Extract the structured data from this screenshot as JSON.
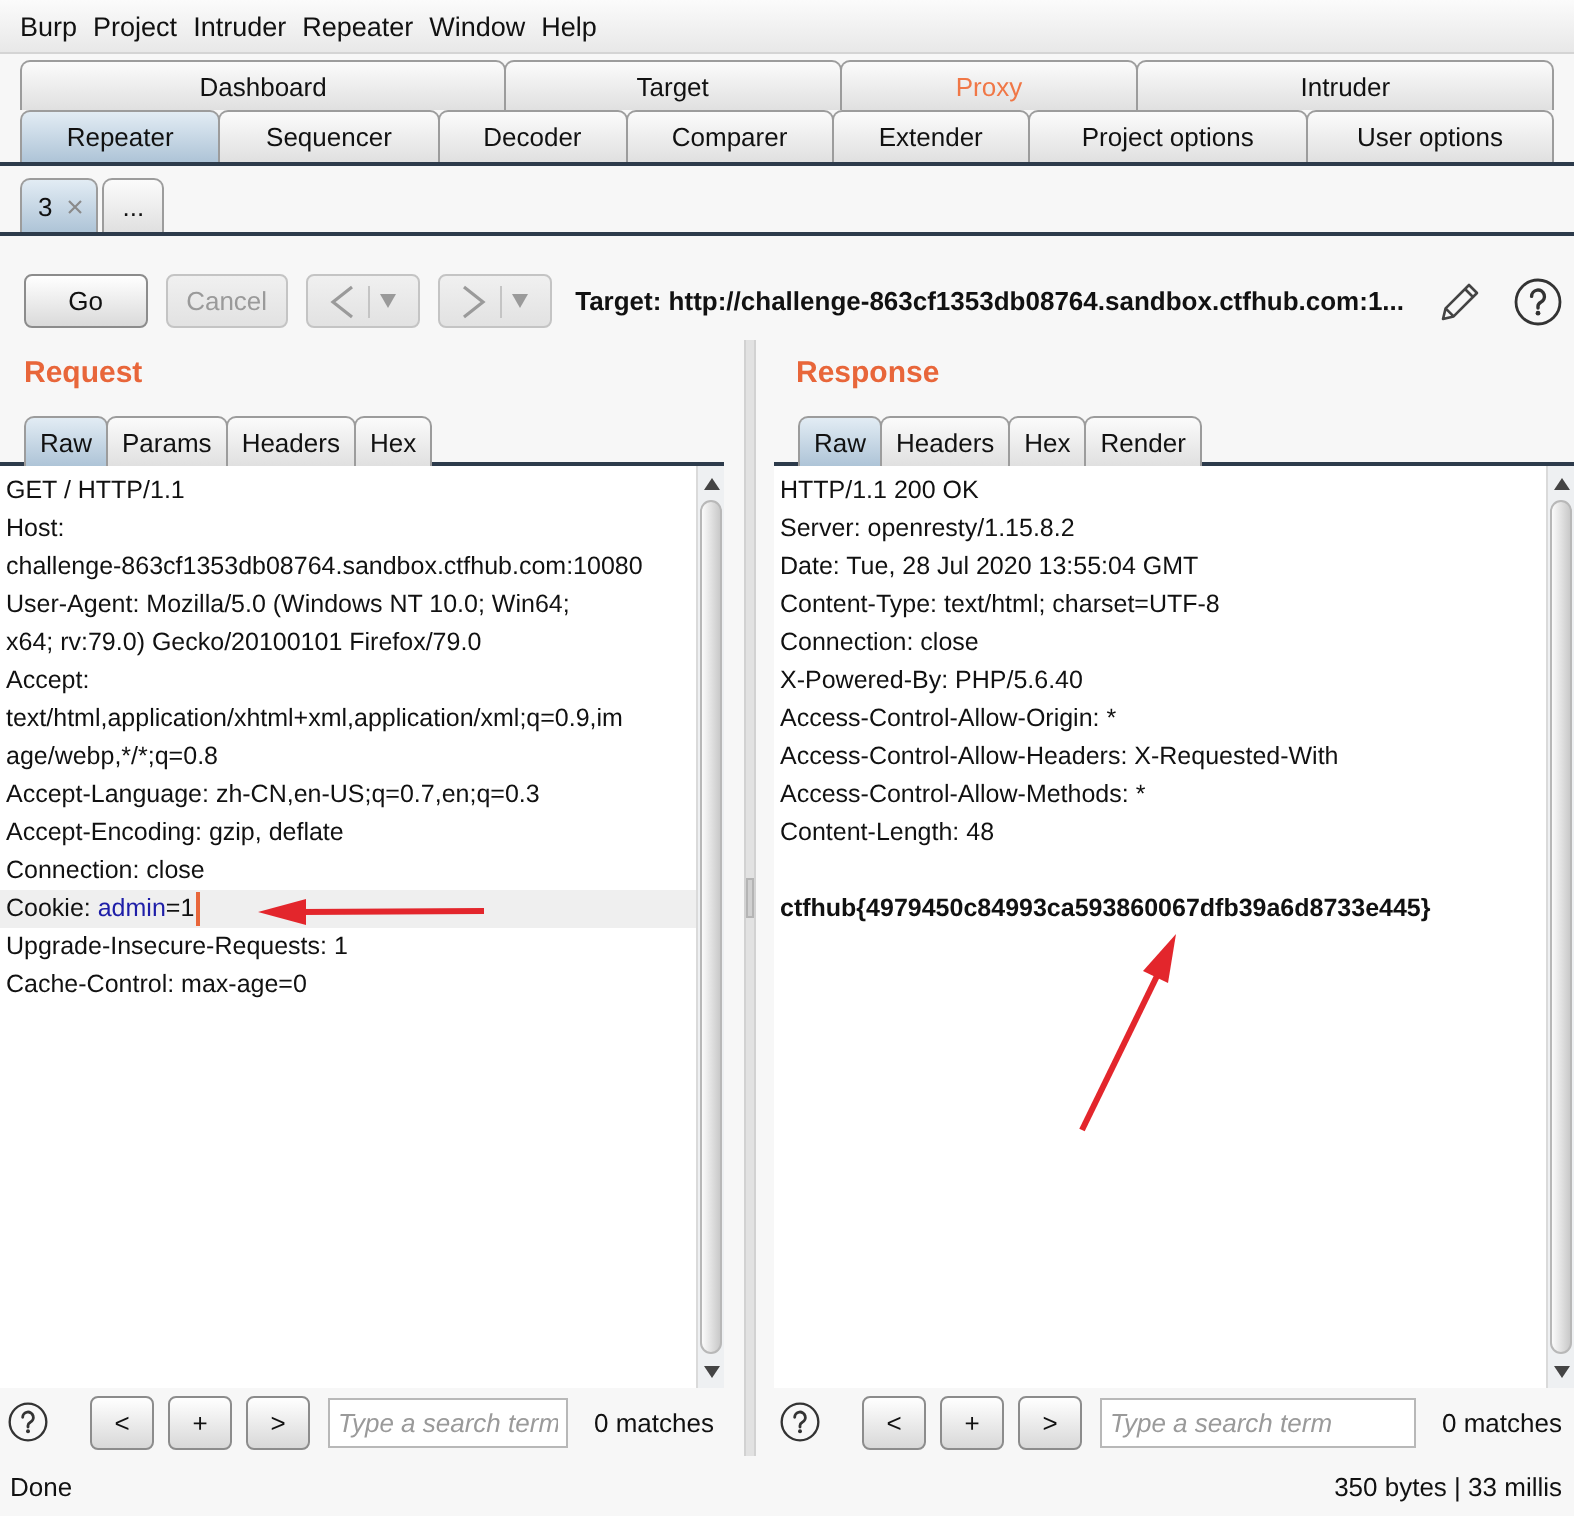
{
  "menu_bar": [
    "Burp",
    "Project",
    "Intruder",
    "Repeater",
    "Window",
    "Help"
  ],
  "main_tabs": [
    [
      {
        "label": "Dashboard",
        "selected": false,
        "highlighted": false
      },
      {
        "label": "Target",
        "selected": false,
        "highlighted": false
      },
      {
        "label": "Proxy",
        "selected": false,
        "highlighted": true
      },
      {
        "label": "Intruder",
        "selected": false,
        "highlighted": false
      }
    ],
    [
      {
        "label": "Repeater",
        "selected": true,
        "highlighted": false
      },
      {
        "label": "Sequencer",
        "selected": false,
        "highlighted": false
      },
      {
        "label": "Decoder",
        "selected": false,
        "highlighted": false
      },
      {
        "label": "Comparer",
        "selected": false,
        "highlighted": false
      },
      {
        "label": "Extender",
        "selected": false,
        "highlighted": false
      },
      {
        "label": "Project options",
        "selected": false,
        "highlighted": false
      },
      {
        "label": "User options",
        "selected": false,
        "highlighted": false
      }
    ]
  ],
  "repeater_tabs": [
    {
      "label": "3",
      "selected": true,
      "closable": true
    },
    {
      "label": "...",
      "selected": false,
      "closable": false
    }
  ],
  "toolbar": {
    "buttons": [
      {
        "kind": "text",
        "label": "Go",
        "disabled": false
      },
      {
        "kind": "text",
        "label": "Cancel",
        "disabled": true
      },
      {
        "kind": "back",
        "disabled": true
      },
      {
        "kind": "forward",
        "disabled": true
      }
    ],
    "target": "Target: http://challenge-863cf1353db08764.sandbox.ctfhub.com:1..."
  },
  "request": {
    "title": "Request",
    "tabs": [
      {
        "label": "Raw",
        "selected": true
      },
      {
        "label": "Params",
        "selected": false
      },
      {
        "label": "Headers",
        "selected": false
      },
      {
        "label": "Hex",
        "selected": false
      }
    ],
    "lines": [
      {
        "text": "GET / HTTP/1.1",
        "highlighted": false
      },
      {
        "text": "Host:",
        "highlighted": false
      },
      {
        "text": "challenge-863cf1353db08764.sandbox.ctfhub.com:10080",
        "highlighted": false
      },
      {
        "text": "User-Agent: Mozilla/5.0 (Windows NT 10.0; Win64;",
        "highlighted": false
      },
      {
        "text": "x64; rv:79.0) Gecko/20100101 Firefox/79.0",
        "highlighted": false
      },
      {
        "text": "Accept:",
        "highlighted": false
      },
      {
        "text": "text/html,application/xhtml+xml,application/xml;q=0.9,im",
        "highlighted": false
      },
      {
        "text": "age/webp,*/*;q=0.8",
        "highlighted": false
      },
      {
        "text": "Accept-Language: zh-CN,en-US;q=0.7,en;q=0.3",
        "highlighted": false
      },
      {
        "text": "Accept-Encoding: gzip, deflate",
        "highlighted": false
      },
      {
        "text": "Connection: close",
        "highlighted": false
      },
      {
        "segments": [
          {
            "text": "Cookie: ",
            "kind": "plain"
          },
          {
            "text": "admin",
            "kind": "param_name"
          },
          {
            "text": "=1",
            "kind": "plain"
          }
        ],
        "highlighted": true
      },
      {
        "text": "Upgrade-Insecure-Requests: 1",
        "highlighted": false
      },
      {
        "text": "Cache-Control: max-age=0",
        "highlighted": false
      }
    ],
    "search": {
      "buttons": [
        "<",
        "+",
        ">"
      ],
      "placeholder": "Type a search term",
      "matches": "0 matches"
    }
  },
  "response": {
    "title": "Response",
    "tabs": [
      {
        "label": "Raw",
        "selected": true
      },
      {
        "label": "Headers",
        "selected": false
      },
      {
        "label": "Hex",
        "selected": false
      },
      {
        "label": "Render",
        "selected": false
      }
    ],
    "lines": [
      "HTTP/1.1 200 OK",
      "Server: openresty/1.15.8.2",
      "Date: Tue, 28 Jul 2020 13:55:04 GMT",
      "Content-Type: text/html; charset=UTF-8",
      "Connection: close",
      "X-Powered-By: PHP/5.6.40",
      "Access-Control-Allow-Origin: *",
      "Access-Control-Allow-Headers: X-Requested-With",
      "Access-Control-Allow-Methods: *",
      "Content-Length: 48"
    ],
    "body": "ctfhub{4979450c84993ca593860067dfb39a6d8733e445}",
    "search": {
      "buttons": [
        "<",
        "+",
        ">"
      ],
      "placeholder": "Type a search term",
      "matches": "0 matches"
    }
  },
  "status_bar": {
    "message": "Done",
    "stats": "350 bytes | 33 millis"
  }
}
